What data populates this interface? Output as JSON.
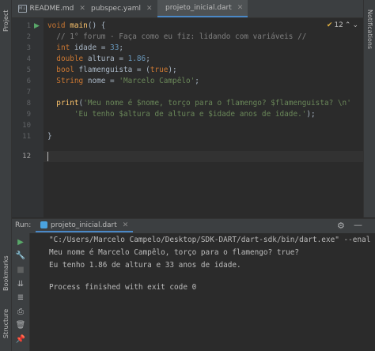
{
  "left_strip": {
    "project": "Project",
    "bookmarks": "Bookmarks",
    "structure": "Structure"
  },
  "right_strip": {
    "notifications": "Notifications"
  },
  "tabs": [
    {
      "label": "README.md",
      "icon": "markdown-icon",
      "active": false
    },
    {
      "label": "pubspec.yaml",
      "icon": "yaml-icon",
      "active": false
    },
    {
      "label": "projeto_inicial.dart",
      "icon": "dart-icon",
      "active": true
    }
  ],
  "editor": {
    "warnings_count": "12",
    "line_numbers": [
      "1",
      "2",
      "3",
      "4",
      "5",
      "6",
      "7",
      "8",
      "9",
      "10",
      "11",
      "12"
    ],
    "current_line": "12"
  },
  "run_panel": {
    "title": "Run:",
    "tab_label": "projeto_inicial.dart",
    "console_lines": [
      "\"C:/Users/Marcelo Campelo/Desktop/SDK-DART/dart-sdk/bin/dart.exe\" --enal",
      "Meu nome é Marcelo Campêlo, torço para o flamengo? true?",
      "Eu tenho 1.86 de altura e 33 anos de idade.",
      "",
      "Process finished with exit code 0"
    ]
  },
  "colors": {
    "accent": "#4a88c7",
    "keyword": "#cc7832",
    "string": "#6a8759",
    "comment": "#808080",
    "function": "#ffc66d",
    "run_green": "#59a869"
  }
}
